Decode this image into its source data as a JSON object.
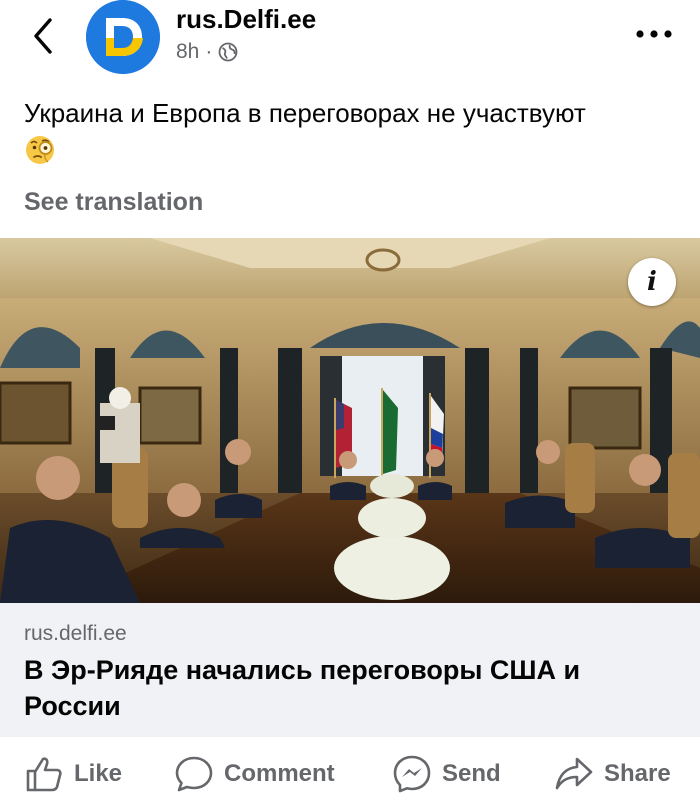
{
  "header": {
    "page_name": "rus.Delfi.ee",
    "time": "8h",
    "separator": "·",
    "audience_icon": "globe-icon",
    "back_icon": "chevron-left-icon",
    "more_icon": "more-dots-icon",
    "avatar_letter": "D"
  },
  "post": {
    "text": "Украина и Европа в переговорах не участвуют",
    "emoji": "face-with-monocle-emoji",
    "see_translation": "See translation"
  },
  "photo": {
    "info_label": "i"
  },
  "link_preview": {
    "domain": "rus.delfi.ee",
    "title": "В Эр-Рияде начались переговоры США и России"
  },
  "actions": {
    "like": "Like",
    "comment": "Comment",
    "send": "Send",
    "share": "Share"
  },
  "colors": {
    "secondary_text": "#65676b",
    "brand_blue": "#1f7ae0",
    "brand_yellow": "#f7c600"
  }
}
